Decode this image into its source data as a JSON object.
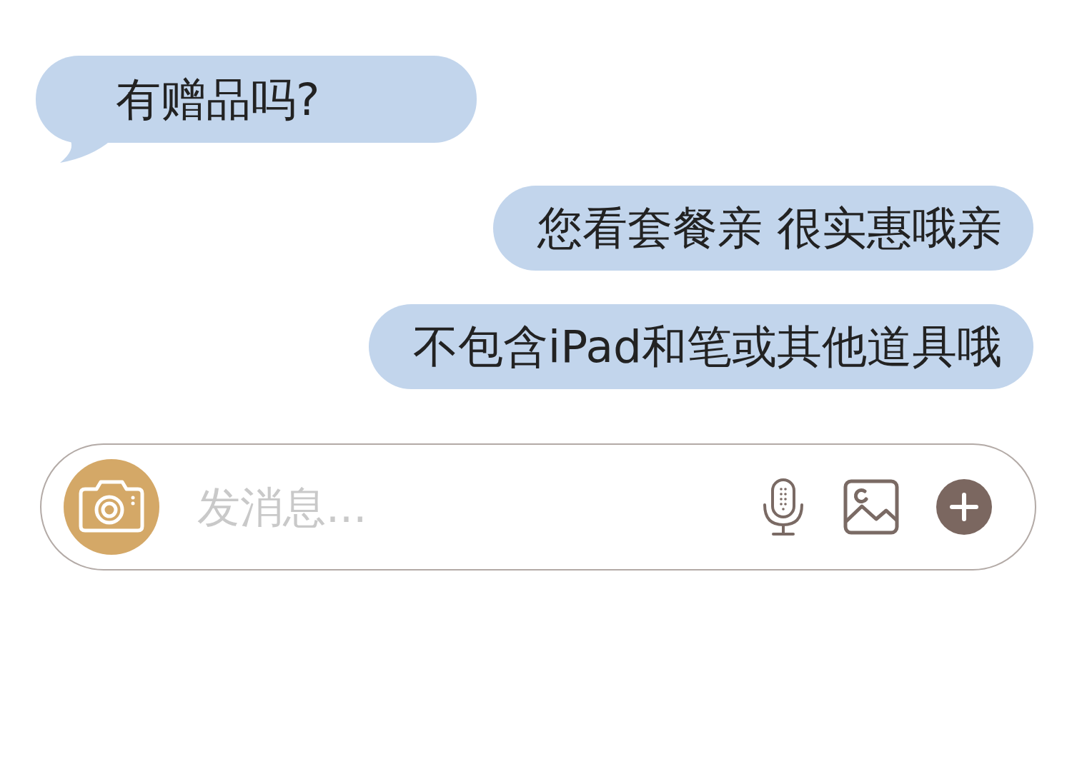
{
  "messages": [
    {
      "kind": "received",
      "text": "有赠品吗?"
    },
    {
      "kind": "sent",
      "text": "您看套餐亲 很实惠哦亲"
    },
    {
      "kind": "sent",
      "text": "不包含iPad和笔或其他道具哦"
    }
  ],
  "composer": {
    "placeholder": "发消息..."
  }
}
